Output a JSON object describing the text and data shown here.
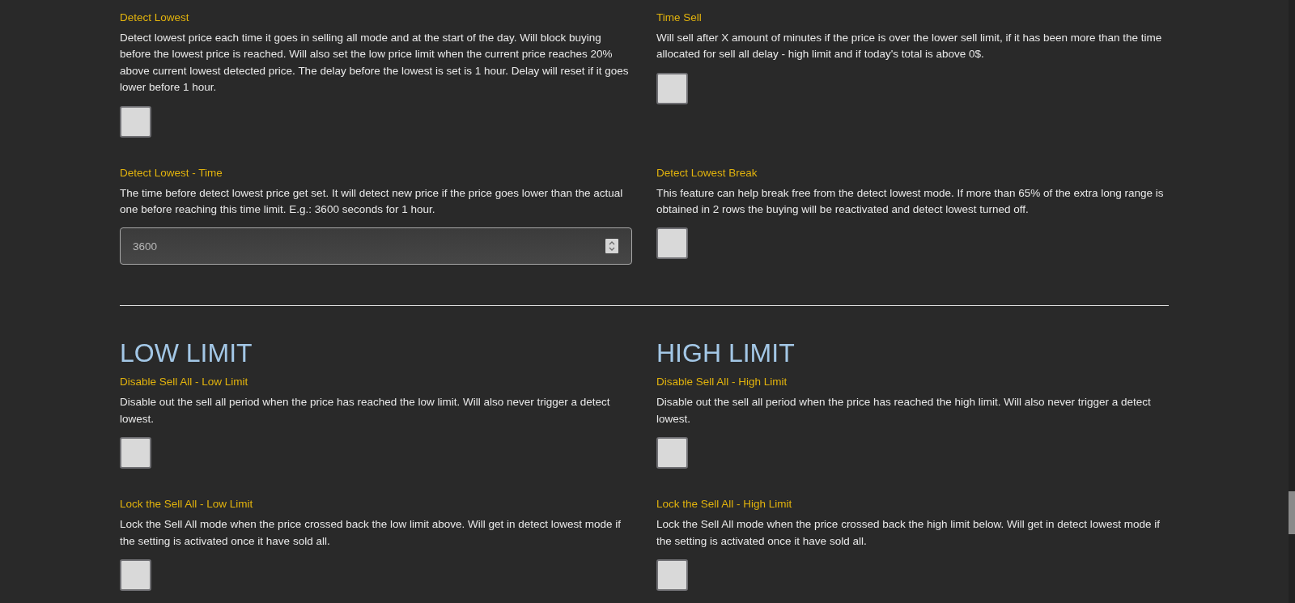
{
  "sections": [
    {
      "rows": [
        {
          "settings": [
            {
              "kind": "checkbox",
              "title": "Detect Lowest",
              "description": "Detect lowest price each time it goes in selling all mode and at the start of the day. Will block buying before the lowest price is reached. Will also set the low price limit when the current price reaches 20% above current lowest detected price. The delay before the lowest is set is 1 hour. Delay will reset if it goes lower before 1 hour.",
              "checked": false
            },
            {
              "kind": "checkbox",
              "title": "Time Sell",
              "description": "Will sell after X amount of minutes if the price is over the lower sell limit, if it has been more than the time allocated for sell all delay - high limit and if today's total is above 0$.",
              "checked": false
            }
          ]
        },
        {
          "settings": [
            {
              "kind": "number",
              "title": "Detect Lowest - Time",
              "description": "The time before detect lowest price get set. It will detect new price if the price goes lower than the actual one before reaching this time limit. E.g.: 3600 seconds for 1 hour.",
              "value": "3600"
            },
            {
              "kind": "checkbox",
              "title": "Detect Lowest Break",
              "description": "This feature can help break free from the detect lowest mode. If more than 65% of the extra long range is obtained in 2 rows the buying will be reactivated and detect lowest turned off.",
              "checked": false
            }
          ]
        }
      ]
    },
    {
      "headings": [
        "LOW LIMIT",
        "HIGH LIMIT"
      ],
      "rows": [
        {
          "settings": [
            {
              "kind": "checkbox",
              "title": "Disable Sell All - Low Limit",
              "description": "Disable out the sell all period when the price has reached the low limit. Will also never trigger a detect lowest.",
              "checked": false
            },
            {
              "kind": "checkbox",
              "title": "Disable Sell All - High Limit",
              "description": "Disable out the sell all period when the price has reached the high limit. Will also never trigger a detect lowest.",
              "checked": false
            }
          ]
        },
        {
          "settings": [
            {
              "kind": "checkbox",
              "title": "Lock the Sell All - Low Limit",
              "description": "Lock the Sell All mode when the price crossed back the low limit above. Will get in detect lowest mode if the setting is activated once it have sold all.",
              "checked": false
            },
            {
              "kind": "checkbox",
              "title": "Lock the Sell All - High Limit",
              "description": "Lock the Sell All mode when the price crossed back the high limit below. Will get in detect lowest mode if the setting is activated once it have sold all.",
              "checked": false
            }
          ]
        }
      ]
    }
  ]
}
